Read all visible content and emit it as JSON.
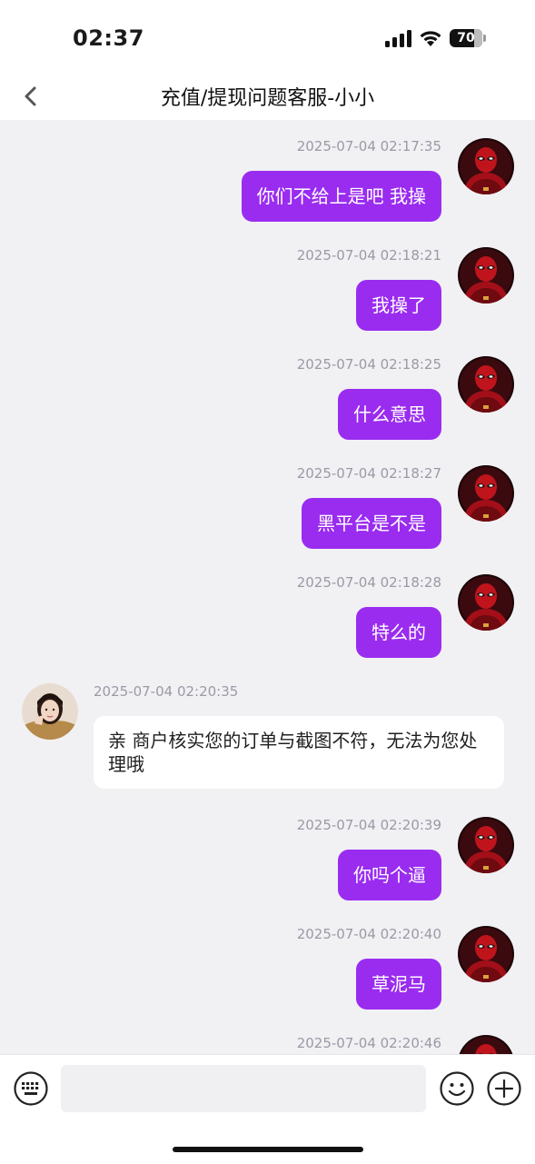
{
  "status_bar": {
    "time": "02:37",
    "battery": "70"
  },
  "header": {
    "title": "充值/提现问题客服-小小"
  },
  "messages": [
    {
      "side": "out",
      "time": "2025-07-04 02:17:35",
      "text": "你们不给上是吧 我操"
    },
    {
      "side": "out",
      "time": "2025-07-04 02:18:21",
      "text": "我操了"
    },
    {
      "side": "out",
      "time": "2025-07-04 02:18:25",
      "text": "什么意思"
    },
    {
      "side": "out",
      "time": "2025-07-04 02:18:27",
      "text": "黑平台是不是"
    },
    {
      "side": "out",
      "time": "2025-07-04 02:18:28",
      "text": "特么的"
    },
    {
      "side": "in",
      "time": "2025-07-04 02:20:35",
      "text": "亲 商户核实您的订单与截图不符，无法为您处理哦"
    },
    {
      "side": "out",
      "time": "2025-07-04 02:20:39",
      "text": "你吗个逼"
    },
    {
      "side": "out",
      "time": "2025-07-04 02:20:40",
      "text": "草泥马"
    },
    {
      "side": "out",
      "time": "2025-07-04 02:20:46",
      "text": ""
    }
  ],
  "input": {
    "placeholder": ""
  },
  "colors": {
    "outgoing_bubble": "#9a2cf0",
    "incoming_bubble": "#ffffff",
    "background": "#f1f1f4"
  },
  "icons": {
    "back": "chevron-left-icon",
    "keyboard": "keyboard-icon",
    "emoji": "emoji-icon",
    "plus": "plus-icon"
  }
}
